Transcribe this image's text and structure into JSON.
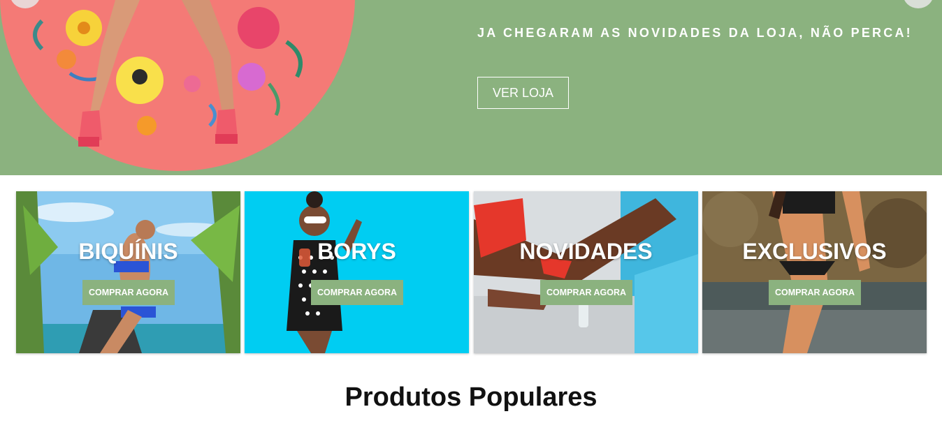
{
  "colors": {
    "brand_green": "#8bb27f",
    "hero_circle": "#f47a76",
    "white": "#ffffff",
    "title_text": "#111111"
  },
  "hero": {
    "tagline": "JA CHEGARAM AS NOVIDADES DA LOJA, NÃO PERCA!",
    "cta_label": "VER LOJA",
    "image_icon": "model-legs-flower-wreath"
  },
  "carousel": {
    "prev_icon": "carousel-prev-dot",
    "next_icon": "carousel-next-dot"
  },
  "categories": [
    {
      "title": "BIQUÍNIS",
      "button": "COMPRAR AGORA",
      "image": "woman-blue-bikini-palms"
    },
    {
      "title": "BORYS",
      "button": "COMPRAR AGORA",
      "image": "woman-polka-swimsuit-cyan"
    },
    {
      "title": "NOVIDADES",
      "button": "COMPRAR AGORA",
      "image": "woman-red-bikini-pool"
    },
    {
      "title": "EXCLUSIVOS",
      "button": "COMPRAR AGORA",
      "image": "woman-black-bikini-beach"
    }
  ],
  "section": {
    "title": "Produtos Populares"
  }
}
